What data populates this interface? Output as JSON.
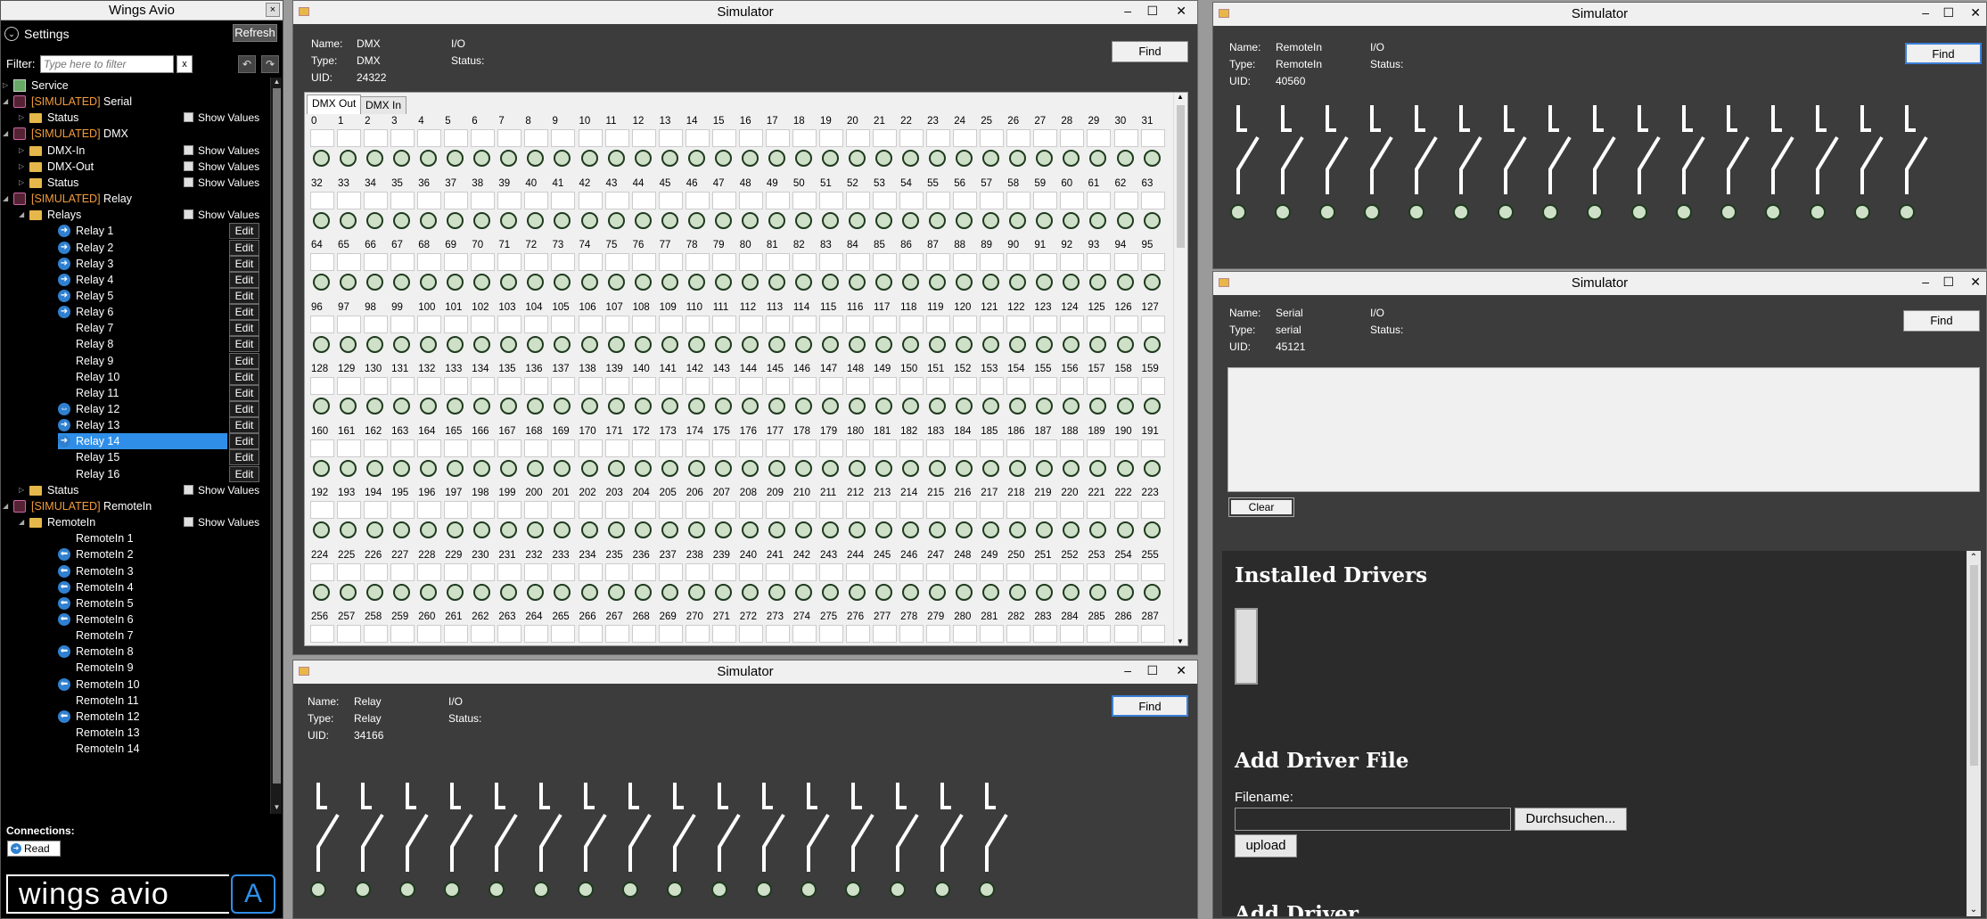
{
  "left": {
    "title": "Wings Avio",
    "close": "×",
    "settings_label": "Settings",
    "refresh": "Refresh",
    "filter_label": "Filter:",
    "filter_placeholder": "Type here to filter",
    "filter_clear": "x",
    "undo_icon": "undo-icon",
    "redo_icon": "redo-icon",
    "tree": [
      {
        "label": "Service",
        "prefix": "",
        "indent": 0,
        "icon": "service",
        "exp": "▷"
      },
      {
        "label": " Serial",
        "prefix": "[SIMULATED]",
        "indent": 0,
        "icon": "gear",
        "exp": "◢"
      },
      {
        "label": "Status",
        "prefix": "",
        "indent": 1,
        "icon": "folder",
        "exp": "▷",
        "show": "Show Values"
      },
      {
        "label": " DMX",
        "prefix": "[SIMULATED]",
        "indent": 0,
        "icon": "gear",
        "exp": "◢"
      },
      {
        "label": "DMX-In",
        "prefix": "",
        "indent": 1,
        "icon": "folder",
        "exp": "▷",
        "show": "Show Values"
      },
      {
        "label": "DMX-Out",
        "prefix": "",
        "indent": 1,
        "icon": "folder",
        "exp": "▷",
        "show": "Show Values"
      },
      {
        "label": "Status",
        "prefix": "",
        "indent": 1,
        "icon": "folder",
        "exp": "▷",
        "show": "Show Values"
      },
      {
        "label": " Relay",
        "prefix": "[SIMULATED]",
        "indent": 0,
        "icon": "gear",
        "exp": "◢"
      },
      {
        "label": "Relays",
        "prefix": "",
        "indent": 1,
        "icon": "folder",
        "exp": "◢",
        "show": "Show Values"
      },
      {
        "label": "Relay 1",
        "indent": 2,
        "icon": "arrow",
        "edit": "Edit"
      },
      {
        "label": "Relay 2",
        "indent": 2,
        "icon": "arrow",
        "edit": "Edit"
      },
      {
        "label": "Relay 3",
        "indent": 2,
        "icon": "arrow",
        "edit": "Edit"
      },
      {
        "label": "Relay 4",
        "indent": 2,
        "icon": "arrow",
        "edit": "Edit"
      },
      {
        "label": "Relay 5",
        "indent": 2,
        "icon": "arrow",
        "edit": "Edit"
      },
      {
        "label": "Relay 6",
        "indent": 2,
        "icon": "arrow",
        "edit": "Edit"
      },
      {
        "label": "Relay 7",
        "indent": 2,
        "icon": "",
        "edit": "Edit"
      },
      {
        "label": "Relay 8",
        "indent": 2,
        "icon": "",
        "edit": "Edit"
      },
      {
        "label": "Relay 9",
        "indent": 2,
        "icon": "",
        "edit": "Edit"
      },
      {
        "label": "Relay 10",
        "indent": 2,
        "icon": "",
        "edit": "Edit"
      },
      {
        "label": "Relay 11",
        "indent": 2,
        "icon": "",
        "edit": "Edit"
      },
      {
        "label": "Relay 12",
        "indent": 2,
        "icon": "arrow2",
        "edit": "Edit"
      },
      {
        "label": "Relay 13",
        "indent": 2,
        "icon": "arrow",
        "edit": "Edit"
      },
      {
        "label": "Relay 14",
        "indent": 2,
        "icon": "arrow",
        "edit": "Edit",
        "selected": true
      },
      {
        "label": "Relay 15",
        "indent": 2,
        "icon": "",
        "edit": "Edit"
      },
      {
        "label": "Relay 16",
        "indent": 2,
        "icon": "",
        "edit": "Edit"
      },
      {
        "label": "Status",
        "prefix": "",
        "indent": 1,
        "icon": "folder",
        "exp": "▷",
        "show": "Show Values"
      },
      {
        "label": " RemoteIn",
        "prefix": "[SIMULATED]",
        "indent": 0,
        "icon": "gear",
        "exp": "◢"
      },
      {
        "label": "RemoteIn",
        "prefix": "",
        "indent": 1,
        "icon": "folder",
        "exp": "◢",
        "show": "Show Values"
      },
      {
        "label": "RemoteIn 1",
        "indent": 2,
        "icon": ""
      },
      {
        "label": "RemoteIn 2",
        "indent": 2,
        "icon": "left"
      },
      {
        "label": "RemoteIn 3",
        "indent": 2,
        "icon": "left"
      },
      {
        "label": "RemoteIn 4",
        "indent": 2,
        "icon": "left"
      },
      {
        "label": "RemoteIn 5",
        "indent": 2,
        "icon": "left"
      },
      {
        "label": "RemoteIn 6",
        "indent": 2,
        "icon": "left"
      },
      {
        "label": "RemoteIn 7",
        "indent": 2,
        "icon": ""
      },
      {
        "label": "RemoteIn 8",
        "indent": 2,
        "icon": "left"
      },
      {
        "label": "RemoteIn 9",
        "indent": 2,
        "icon": ""
      },
      {
        "label": "RemoteIn 10",
        "indent": 2,
        "icon": "left"
      },
      {
        "label": "RemoteIn 11",
        "indent": 2,
        "icon": ""
      },
      {
        "label": "RemoteIn 12",
        "indent": 2,
        "icon": "left"
      },
      {
        "label": "RemoteIn 13",
        "indent": 2,
        "icon": ""
      },
      {
        "label": "RemoteIn 14",
        "indent": 2,
        "icon": ""
      }
    ],
    "connections_label": "Connections:",
    "read_btn": "Read",
    "logo_text": "wings avio",
    "logo_mark": "A"
  },
  "dmx_window": {
    "title": "Simulator",
    "name_label": "Name:",
    "name": "DMX",
    "type_label": "Type:",
    "type": "DMX",
    "uid_label": "UID:",
    "uid": "24322",
    "io_label": "I/O",
    "status_label": "Status:",
    "find": "Find",
    "tabs": [
      "DMX Out",
      "DMX In"
    ],
    "channel_rows": 9,
    "channels_per_row": 32,
    "scroll_ratio": 0.27
  },
  "relay_window": {
    "title": "Simulator",
    "name_label": "Name:",
    "name": "Relay",
    "type_label": "Type:",
    "type": "Relay",
    "uid_label": "UID:",
    "uid": "34166",
    "io_label": "I/O",
    "status_label": "Status:",
    "find": "Find",
    "relay_count": 16
  },
  "remote_window": {
    "title": "Simulator",
    "name_label": "Name:",
    "name": "RemoteIn",
    "type_label": "Type:",
    "type": "RemoteIn",
    "uid_label": "UID:",
    "uid": "40560",
    "io_label": "I/O",
    "status_label": "Status:",
    "find": "Find",
    "relay_count": 16
  },
  "serial_window": {
    "title": "Simulator",
    "name_label": "Name:",
    "name": "Serial",
    "type_label": "Type:",
    "type": "serial",
    "uid_label": "UID:",
    "uid": "45121",
    "io_label": "I/O",
    "status_label": "Status:",
    "find": "Find",
    "clear": "Clear",
    "web": {
      "installed_drivers": "Installed Drivers",
      "add_driver_file": "Add Driver File",
      "filename_label": "Filename:",
      "browse": "Durchsuchen...",
      "upload": "upload",
      "cut_heading": "Add Driver"
    }
  },
  "window_controls": {
    "min": "–",
    "max": "☐",
    "close": "✕"
  }
}
